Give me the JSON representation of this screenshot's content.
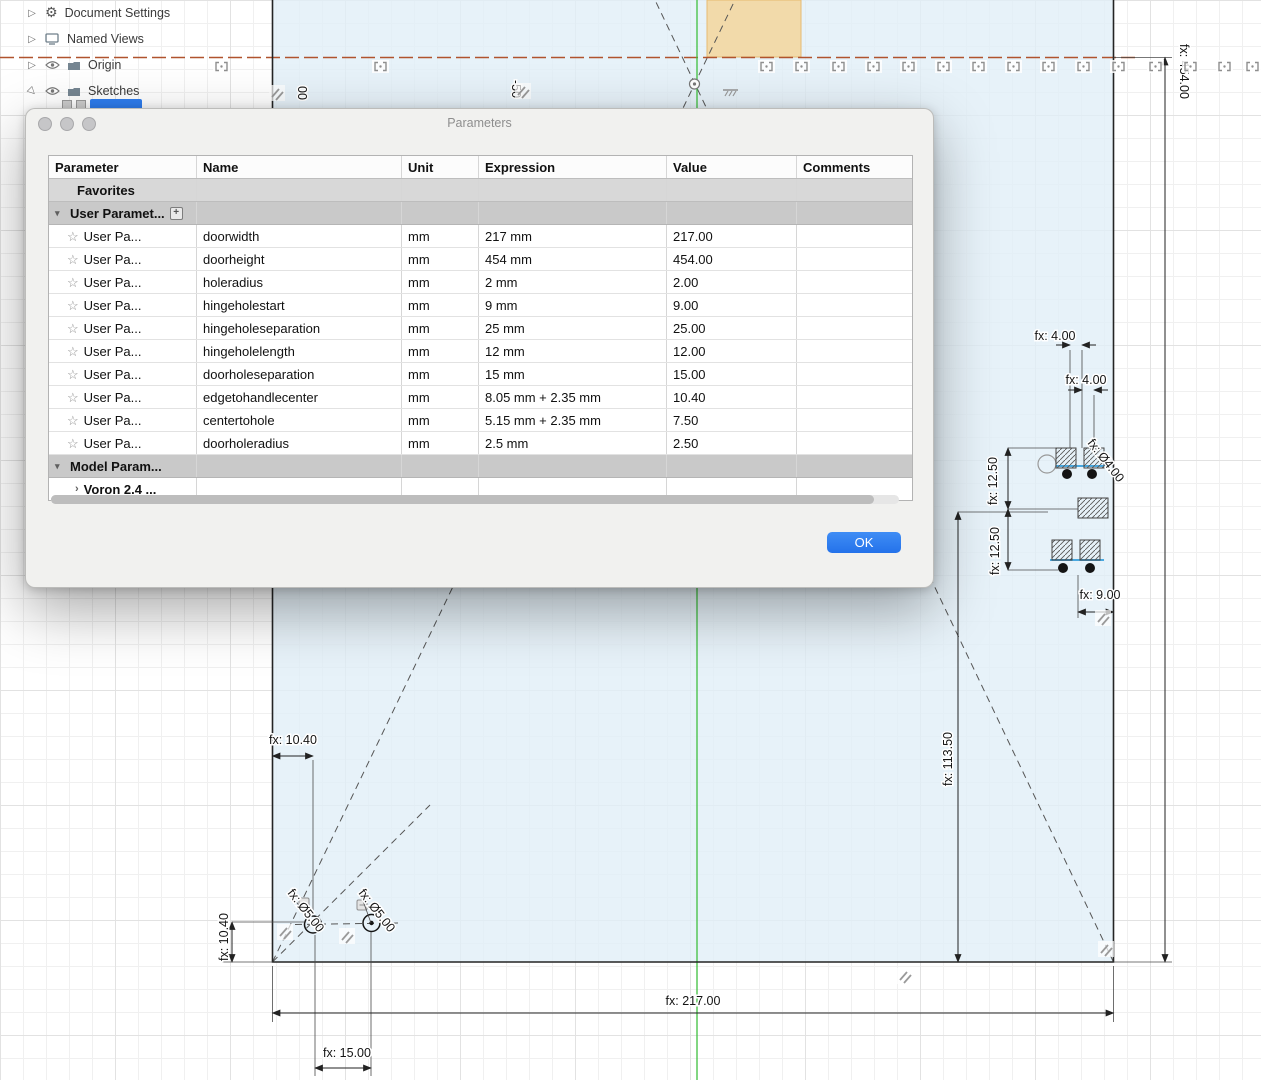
{
  "browser": {
    "items": [
      {
        "label": "Document Settings"
      },
      {
        "label": "Named Views"
      },
      {
        "label": "Origin"
      },
      {
        "label": "Sketches"
      }
    ]
  },
  "dialog": {
    "title": "Parameters",
    "ok_label": "OK",
    "headers": {
      "parameter": "Parameter",
      "name": "Name",
      "unit": "Unit",
      "expression": "Expression",
      "value": "Value",
      "comments": "Comments"
    },
    "groups": {
      "favorites": "Favorites",
      "user_parameters": "User Paramet...",
      "model_parameters": "Model Param...",
      "model_child": "Voron 2.4 ..."
    },
    "row_label": "User Pa...",
    "rows": [
      {
        "name": "doorwidth",
        "unit": "mm",
        "expression": "217 mm",
        "value": "217.00"
      },
      {
        "name": "doorheight",
        "unit": "mm",
        "expression": "454 mm",
        "value": "454.00"
      },
      {
        "name": "holeradius",
        "unit": "mm",
        "expression": "2 mm",
        "value": "2.00"
      },
      {
        "name": "hingeholestart",
        "unit": "mm",
        "expression": "9 mm",
        "value": "9.00"
      },
      {
        "name": "hingeholeseparation",
        "unit": "mm",
        "expression": "25 mm",
        "value": "25.00"
      },
      {
        "name": "hingeholelength",
        "unit": "mm",
        "expression": "12 mm",
        "value": "12.00"
      },
      {
        "name": "doorholeseparation",
        "unit": "mm",
        "expression": "15 mm",
        "value": "15.00"
      },
      {
        "name": "edgetohandlecenter",
        "unit": "mm",
        "expression": "8.05 mm + 2.35 mm",
        "value": "10.40"
      },
      {
        "name": "centertohole",
        "unit": "mm",
        "expression": "5.15 mm + 2.35 mm",
        "value": "7.50"
      },
      {
        "name": "doorholeradius",
        "unit": "mm",
        "expression": "2.5 mm",
        "value": "2.50"
      }
    ]
  },
  "canvas": {
    "dims": {
      "door_height": "fx: 454.00",
      "door_width": "fx: 217.00",
      "handle_height": "fx: 113.50",
      "hole_separation": "fx: 15.00",
      "edge_to_handle": "fx: 10.40",
      "edge_to_handle_vertical": "fx: 10.40",
      "hinge_gap_a": "fx: 4.00",
      "hinge_gap_b": "fx: 4.00",
      "hinge_separation_a": "fx: 12.50",
      "hinge_separation_b": "fx: 12.50",
      "hinge_start": "fx: 9.00",
      "hinge_hole_diameter": "fx: Ø4.00",
      "door_hole_diameter_a": "fx: Ø5.00",
      "door_hole_diameter_b": "fx: Ø5.00",
      "partial_label_a": "00",
      "partial_label_b": "-50"
    }
  },
  "colors": {
    "accent_blue": "#2f7ef0",
    "sketch_green": "#3fbf3f",
    "construction_red": "#b0532e",
    "sketch_fill": "#e1eff8"
  }
}
